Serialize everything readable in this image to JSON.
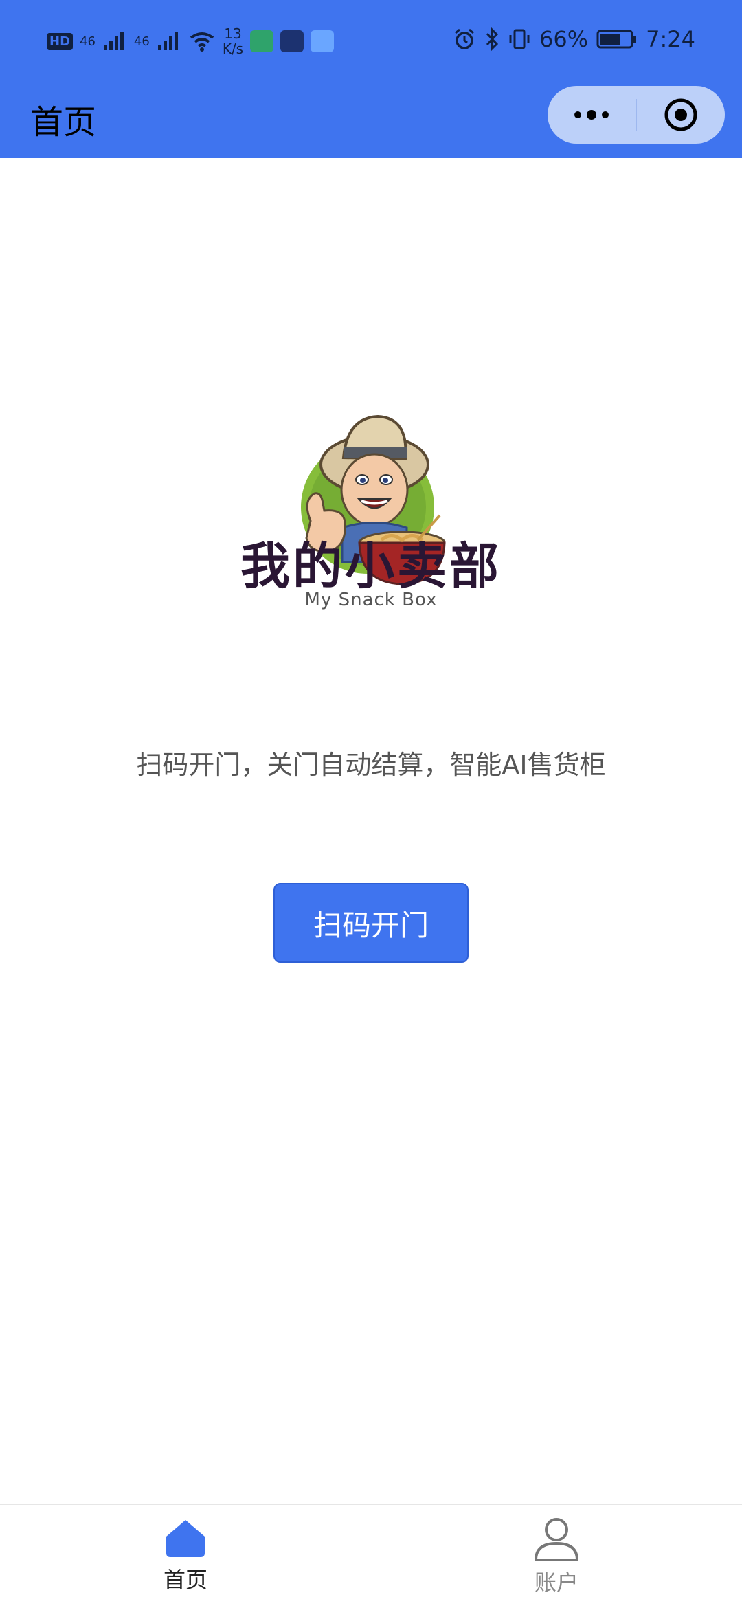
{
  "status_bar": {
    "hd": "HD",
    "signal1": "46",
    "signal2": "46",
    "speed_value": "13",
    "speed_unit": "K/s",
    "battery": "66%",
    "time": "7:24"
  },
  "nav": {
    "title": "首页"
  },
  "main": {
    "brand_cn": "我的小卖部",
    "brand_en": "My Snack Box",
    "slogan": "扫码开门，关门自动结算，智能AI售货柜",
    "scan_button": "扫码开门"
  },
  "tabbar": {
    "home_label": "首页",
    "account_label": "账户",
    "active": "home"
  },
  "colors": {
    "accent": "#3f74ef",
    "inactive_tab": "#888888"
  }
}
